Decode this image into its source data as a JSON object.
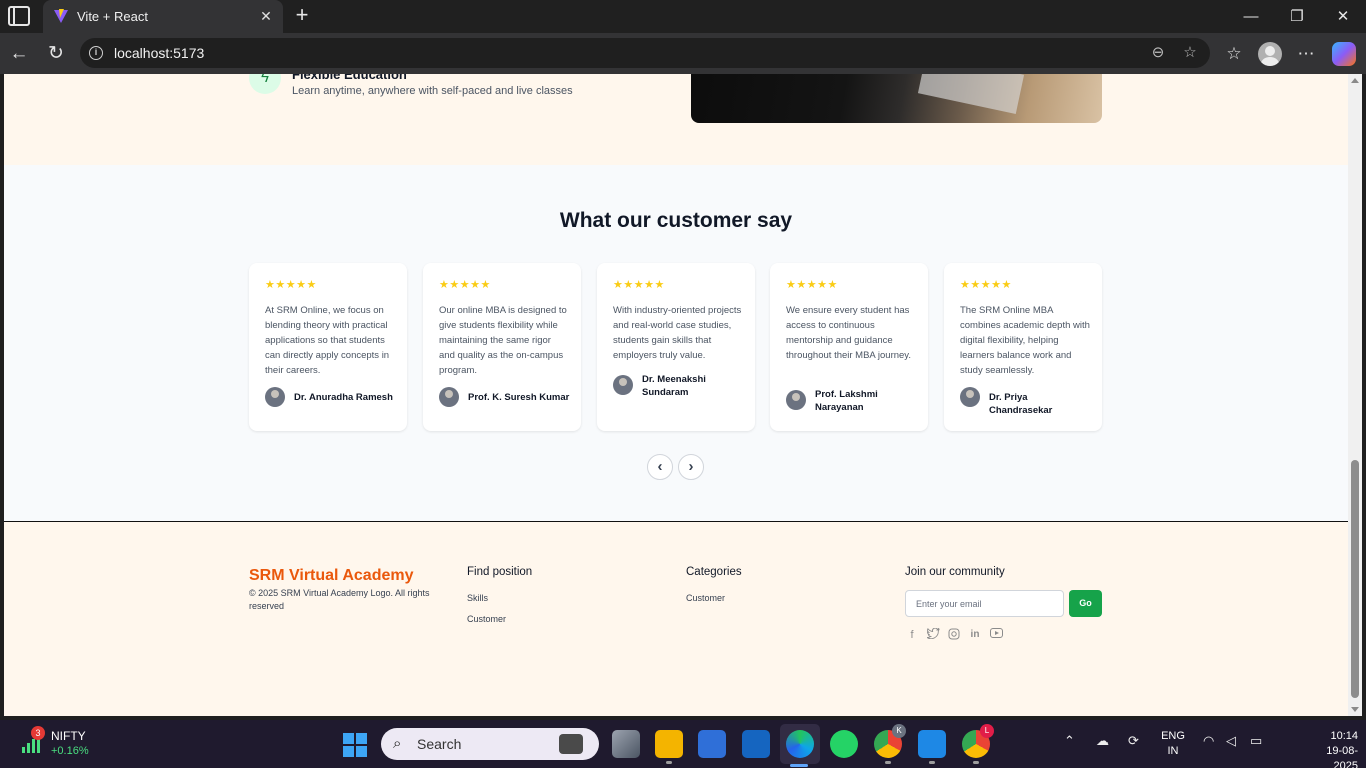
{
  "browser": {
    "tab_title": "Vite + React",
    "url": "localhost:5173"
  },
  "feature": {
    "title": "Flexible Education",
    "description": "Learn anytime, anywhere with self-paced and live classes"
  },
  "testimonials": {
    "heading": "What our customer say",
    "stars": "★★★★★",
    "items": [
      {
        "quote": "At SRM Online, we focus on blending theory with practical applications so that students can directly apply concepts in their careers.",
        "author": "Dr. Anuradha Ramesh"
      },
      {
        "quote": "Our online MBA is designed to give students flexibility while maintaining the same rigor and quality as the on-campus program.",
        "author": "Prof. K. Suresh Kumar"
      },
      {
        "quote": "With industry-oriented projects and real-world case studies, students gain skills that employers truly value.",
        "author": "Dr. Meenakshi Sundaram"
      },
      {
        "quote": "We ensure every student has access to continuous mentorship and guidance throughout their MBA journey.",
        "author": "Prof. Lakshmi Narayanan"
      },
      {
        "quote": "The SRM Online MBA combines academic depth with digital flexibility, helping learners balance work and study seamlessly.",
        "author": "Dr. Priya Chandrasekar"
      }
    ]
  },
  "footer": {
    "brand": "SRM Virtual Academy",
    "copyright": "© 2025 SRM Virtual Academy Logo. All rights reserved",
    "col1": {
      "heading": "Find position",
      "links": [
        "Skills",
        "Customer"
      ]
    },
    "col2": {
      "heading": "Categories",
      "links": [
        "Customer"
      ]
    },
    "col3": {
      "heading": "Join our community",
      "email_placeholder": "Enter your email",
      "button": "Go"
    }
  },
  "taskbar": {
    "widget_badge": "3",
    "widget_title": "NIFTY",
    "widget_value": "+0.16%",
    "search_placeholder": "Search",
    "lang_line1": "ENG",
    "lang_line2": "IN",
    "time": "10:14",
    "date": "19-08-2025",
    "chrome_badge_1": "K",
    "chrome_badge_2": "L"
  },
  "colors": {
    "brand": "#ea580c",
    "go_button": "#16a34a",
    "stars": "#facc15",
    "section_cream": "#fff7ed"
  }
}
